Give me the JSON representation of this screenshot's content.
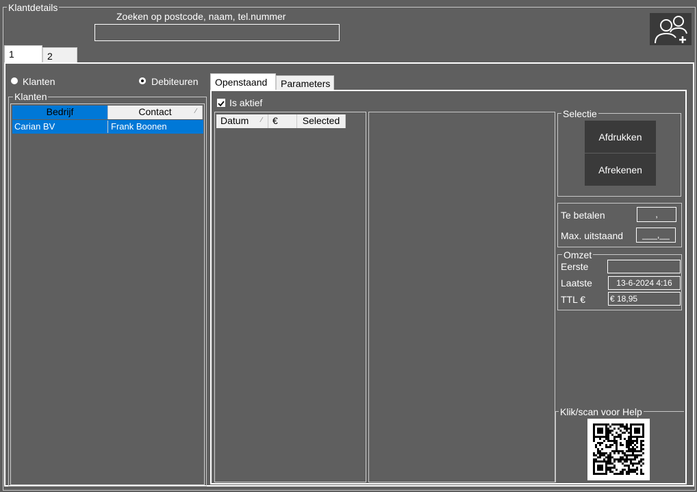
{
  "window": {
    "title": "Klantdetails"
  },
  "search": {
    "label": "Zoeken op postcode, naam, tel.nummer",
    "value": "",
    "placeholder": ""
  },
  "main_tabs": [
    {
      "label": "1"
    },
    {
      "label": "2"
    }
  ],
  "filter": {
    "klanten_label": "Klanten",
    "debiteuren_label": "Debiteuren",
    "selected": "Debiteuren"
  },
  "klanten_group": {
    "title": "Klanten",
    "columns": [
      "Bedrijf",
      "Contact"
    ],
    "rows": [
      {
        "bedrijf": "Carian BV",
        "contact": "Frank Boonen"
      }
    ]
  },
  "detail_tabs": [
    {
      "label": "Openstaand"
    },
    {
      "label": "Parameters"
    }
  ],
  "openstaand": {
    "is_aktief_label": "Is aktief",
    "is_aktief_checked": true,
    "columns": [
      "Datum",
      "€",
      "Selected"
    ]
  },
  "selectie": {
    "title": "Selectie",
    "print_label": "Afdrukken",
    "pay_label": "Afrekenen"
  },
  "amounts": {
    "te_betalen_label": "Te betalen",
    "te_betalen_value": ",",
    "max_uitstaand_label": "Max. uitstaand",
    "max_uitstaand_value": "___,__"
  },
  "omzet": {
    "title": "Omzet",
    "eerste_label": "Eerste",
    "eerste_value": "",
    "laatste_label": "Laatste",
    "laatste_value": "13-6-2024 4:16",
    "ttl_label": "TTL €",
    "ttl_value": "€ 18,95"
  },
  "help": {
    "title": "Klik/scan voor Help"
  },
  "icons": {
    "add_user": "add-user-icon",
    "qr": "qr-code-icon",
    "checkbox": "check-icon"
  },
  "colors": {
    "background": "#5f5f5f",
    "selection": "#0078d7",
    "button": "#3a3a3a"
  }
}
